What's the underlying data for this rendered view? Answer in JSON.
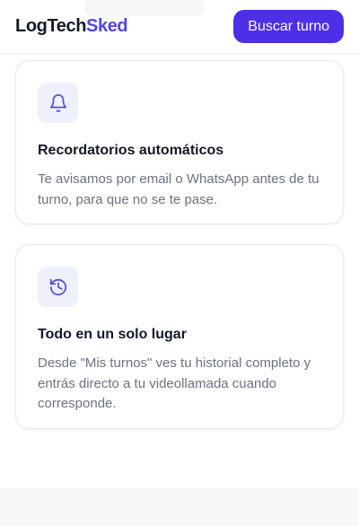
{
  "header": {
    "brand_part1": "LogTech",
    "brand_part2": "Sked",
    "cta_label": "Buscar turno"
  },
  "features": [
    {
      "icon": "bell-icon",
      "title": "Recordatorios automáticos",
      "text": "Te avisamos por email o WhatsApp antes de tu turno, para que no se te pase."
    },
    {
      "icon": "history-icon",
      "title": "Todo en un solo lugar",
      "text": "Desde \"Mis turnos\" ves tu historial completo y entrás directo a tu videollamada cuando corresponde."
    }
  ],
  "colors": {
    "brand_accent": "#4f46e5",
    "cta_background": "#4f2ee8",
    "icon_tint": "#4f46e5",
    "icon_background": "#eef0fc"
  }
}
